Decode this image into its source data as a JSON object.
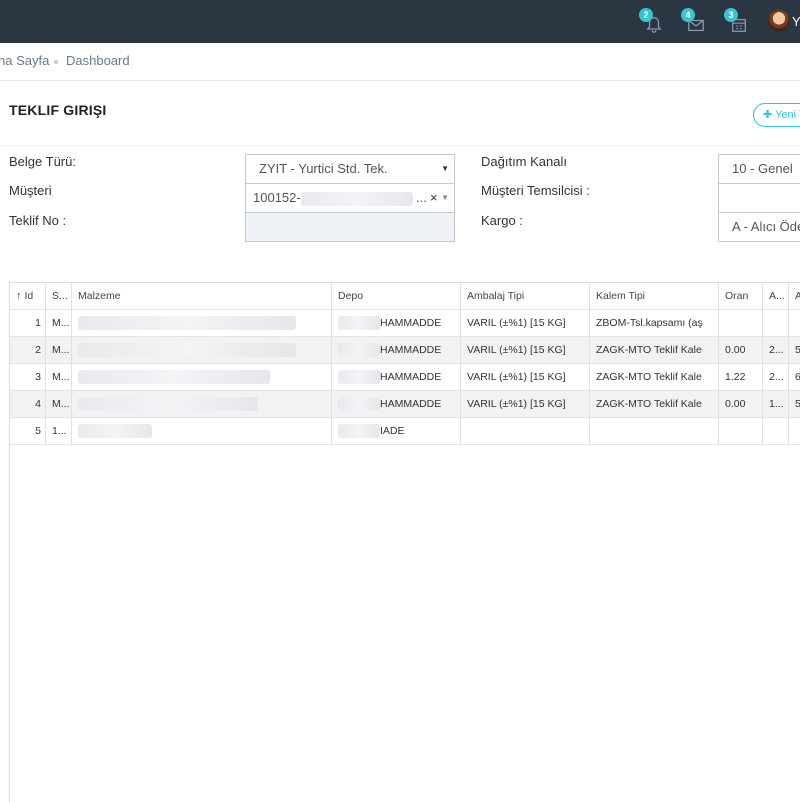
{
  "topbar": {
    "notifications": {
      "icon": "bell-icon",
      "count": "2"
    },
    "messages": {
      "icon": "envelope-icon",
      "count": "4"
    },
    "tasks": {
      "icon": "calendar-icon",
      "count": "3"
    },
    "user_name": "Yi"
  },
  "breadcrumb": {
    "items": [
      "na Sayfa",
      "Dashboard"
    ]
  },
  "page": {
    "title": "TEKLIF GIRIŞI",
    "new_button_label": "Yeni T"
  },
  "form": {
    "belge_turu": {
      "label": "Belge Türü:",
      "value": "ZYIT - Yurtici Std. Tek."
    },
    "musteri": {
      "label": "Müşteri",
      "value": "100152-",
      "ellipsis": "...",
      "clear": "×"
    },
    "teklif_no": {
      "label": "Teklif No :",
      "value": ""
    },
    "dagitim_kanali": {
      "label": "Dağıtım Kanalı",
      "value": "10 - Genel"
    },
    "musteri_temsilcisi": {
      "label": "Müşteri Temsilcisi :",
      "value": ""
    },
    "kargo": {
      "label": "Kargo :",
      "value": "A - Alıcı Öde"
    }
  },
  "grid": {
    "sort_icon": "arrow-up-icon",
    "columns": [
      "Id",
      "S...",
      "Malzeme",
      "Depo",
      "Ambalaj Tipi",
      "Kalem Tipi",
      "Oran",
      "A...",
      "A"
    ],
    "rows": [
      {
        "id": "1",
        "s": "M...",
        "malzeme": "",
        "depo": "HAMMADDE",
        "ambalaj": "VARIL (±%1) [15 KG]",
        "kalem": "ZBOM-Tsl.kapsamı (aş",
        "oran": "",
        "a1": "",
        "a2": ""
      },
      {
        "id": "2",
        "s": "M...",
        "malzeme": "",
        "depo": "HAMMADDE",
        "ambalaj": "VARIL (±%1) [15 KG]",
        "kalem": "ZAGK-MTO Teklif Kale",
        "oran": "0.00",
        "a1": "2...",
        "a2": "5"
      },
      {
        "id": "3",
        "s": "M...",
        "malzeme": "",
        "depo": "HAMMADDE",
        "ambalaj": "VARIL (±%1) [15 KG]",
        "kalem": "ZAGK-MTO Teklif Kale",
        "oran": "1.22",
        "a1": "2...",
        "a2": "6"
      },
      {
        "id": "4",
        "s": "M...",
        "malzeme": "",
        "depo": "HAMMADDE",
        "ambalaj": "VARIL (±%1) [15 KG]",
        "kalem": "ZAGK-MTO Teklif Kale",
        "oran": "0.00",
        "a1": "1...",
        "a2": "5"
      },
      {
        "id": "5",
        "s": "1...",
        "malzeme": "",
        "depo": "IADE",
        "ambalaj": "",
        "kalem": "",
        "oran": "",
        "a1": "",
        "a2": ""
      }
    ]
  },
  "colors": {
    "topbar_bg": "#2b3643",
    "badge": "#36c6d3",
    "accent_button": "#32c5d2",
    "row_alt": "#f2f2f2"
  }
}
